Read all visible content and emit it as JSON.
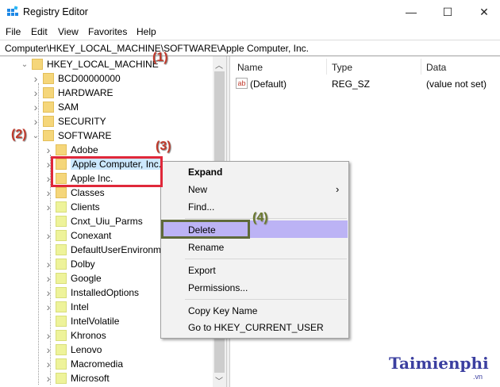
{
  "window": {
    "title": "Registry Editor",
    "minimize": "—",
    "maximize": "☐",
    "close": "✕"
  },
  "menubar": [
    "File",
    "Edit",
    "View",
    "Favorites",
    "Help"
  ],
  "address": "Computer\\HKEY_LOCAL_MACHINE\\SOFTWARE\\Apple Computer, Inc.",
  "tree": [
    {
      "label": "HKEY_LOCAL_MACHINE",
      "level": 0,
      "chev": "down",
      "color": "y"
    },
    {
      "label": "BCD00000000",
      "level": 1,
      "chev": "right",
      "color": "y"
    },
    {
      "label": "HARDWARE",
      "level": 1,
      "chev": "right",
      "color": "y"
    },
    {
      "label": "SAM",
      "level": 1,
      "chev": "right",
      "color": "y"
    },
    {
      "label": "SECURITY",
      "level": 1,
      "chev": "right",
      "color": "y"
    },
    {
      "label": "SOFTWARE",
      "level": 1,
      "chev": "down",
      "color": "y"
    },
    {
      "label": "Adobe",
      "level": 2,
      "chev": "right",
      "color": "y"
    },
    {
      "label": "Apple Computer, Inc.",
      "level": 2,
      "chev": "right",
      "color": "y",
      "selected": true
    },
    {
      "label": "Apple Inc.",
      "level": 2,
      "chev": "right",
      "color": "y"
    },
    {
      "label": "Classes",
      "level": 2,
      "chev": "right",
      "color": "y"
    },
    {
      "label": "Clients",
      "level": 2,
      "chev": "right",
      "color": "g"
    },
    {
      "label": "Cnxt_Uiu_Parms",
      "level": 2,
      "chev": "none",
      "color": "g"
    },
    {
      "label": "Conexant",
      "level": 2,
      "chev": "right",
      "color": "g"
    },
    {
      "label": "DefaultUserEnvironm",
      "level": 2,
      "chev": "none",
      "color": "g"
    },
    {
      "label": "Dolby",
      "level": 2,
      "chev": "right",
      "color": "g"
    },
    {
      "label": "Google",
      "level": 2,
      "chev": "right",
      "color": "g"
    },
    {
      "label": "InstalledOptions",
      "level": 2,
      "chev": "right",
      "color": "g"
    },
    {
      "label": "Intel",
      "level": 2,
      "chev": "right",
      "color": "g"
    },
    {
      "label": "IntelVolatile",
      "level": 2,
      "chev": "none",
      "color": "g"
    },
    {
      "label": "Khronos",
      "level": 2,
      "chev": "right",
      "color": "g"
    },
    {
      "label": "Lenovo",
      "level": 2,
      "chev": "right",
      "color": "g"
    },
    {
      "label": "Macromedia",
      "level": 2,
      "chev": "right",
      "color": "g"
    },
    {
      "label": "Microsoft",
      "level": 2,
      "chev": "right",
      "color": "g"
    }
  ],
  "values": {
    "headers": {
      "name": "Name",
      "type": "Type",
      "data": "Data"
    },
    "rows": [
      {
        "icon": "ab",
        "name": "(Default)",
        "type": "REG_SZ",
        "data": "(value not set)"
      }
    ]
  },
  "context_menu": {
    "expand": "Expand",
    "new": "New",
    "new_arrow": "›",
    "find": "Find...",
    "delete": "Delete",
    "rename": "Rename",
    "export": "Export",
    "permissions": "Permissions...",
    "copy_key": "Copy Key Name",
    "goto": "Go to HKEY_CURRENT_USER"
  },
  "annotations": {
    "a1": "(1)",
    "a2": "(2)",
    "a3": "(3)",
    "a4": "(4)"
  },
  "watermark": {
    "brand": "Taimienphi",
    "domain": ".vn"
  },
  "colors": {
    "highlight": "#bcb3f5",
    "red_box": "#e0283a",
    "green_box": "#5f6a3a"
  }
}
